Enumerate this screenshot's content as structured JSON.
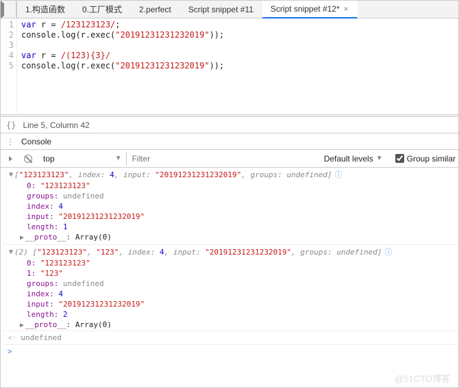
{
  "tabs": [
    {
      "label": "1.构造函数"
    },
    {
      "label": "0.工厂模式"
    },
    {
      "label": "2.perfect"
    },
    {
      "label": "Script snippet #11"
    },
    {
      "label": "Script snippet #12*",
      "active": true
    }
  ],
  "editor": {
    "lines": [
      {
        "n": "1",
        "kw": "var",
        "body": " r = ",
        "rx": "/123123123/",
        "tail": ";"
      },
      {
        "n": "2",
        "body": "console.log(r.exec(",
        "str": "\"20191231231232019\"",
        "tail": "));"
      },
      {
        "n": "3",
        "body": ""
      },
      {
        "n": "4",
        "kw": "var",
        "body": " r = ",
        "rx": "/(123){3}/",
        "tail": ""
      },
      {
        "n": "5",
        "body": "console.log(r.exec(",
        "str": "\"20191231231232019\"",
        "tail": "));"
      }
    ]
  },
  "status": {
    "braces": "{}",
    "text": "Line 5, Column 42"
  },
  "drawer": {
    "tab": "Console"
  },
  "toolbar": {
    "context": "top",
    "filter_placeholder": "Filter",
    "levels": "Default levels",
    "group": "Group similar"
  },
  "results": [
    {
      "summary": {
        "arr": "[",
        "s0": "\"123123123\"",
        "idx_k": "index:",
        "idx_v": "4",
        "inp_k": "input:",
        "inp_v": "\"20191231231232019\"",
        "grp_k": "groups:",
        "grp_v": "undefined",
        "close": "]"
      },
      "props": [
        {
          "k": "0:",
          "v": "\"123123123\"",
          "type": "str"
        },
        {
          "k": "groups:",
          "v": "undefined",
          "type": "undef"
        },
        {
          "k": "index:",
          "v": "4",
          "type": "num"
        },
        {
          "k": "input:",
          "v": "\"20191231231232019\"",
          "type": "str"
        },
        {
          "k": "length:",
          "v": "1",
          "type": "num"
        }
      ],
      "proto": {
        "k": "__proto__:",
        "v": "Array(0)"
      }
    },
    {
      "summary": {
        "len": "(2)",
        "arr": "[",
        "s0": "\"123123123\"",
        "s1": "\"123\"",
        "idx_k": "index:",
        "idx_v": "4",
        "inp_k": "input:",
        "inp_v": "\"20191231231232019\"",
        "grp_k": "groups:",
        "grp_v": "undefined",
        "close": "]"
      },
      "props": [
        {
          "k": "0:",
          "v": "\"123123123\"",
          "type": "str"
        },
        {
          "k": "1:",
          "v": "\"123\"",
          "type": "str"
        },
        {
          "k": "groups:",
          "v": "undefined",
          "type": "undef"
        },
        {
          "k": "index:",
          "v": "4",
          "type": "num"
        },
        {
          "k": "input:",
          "v": "\"20191231231232019\"",
          "type": "str"
        },
        {
          "k": "length:",
          "v": "2",
          "type": "num"
        }
      ],
      "proto": {
        "k": "__proto__:",
        "v": "Array(0)"
      }
    }
  ],
  "return_value": "undefined",
  "watermark": "@51CTO博客"
}
